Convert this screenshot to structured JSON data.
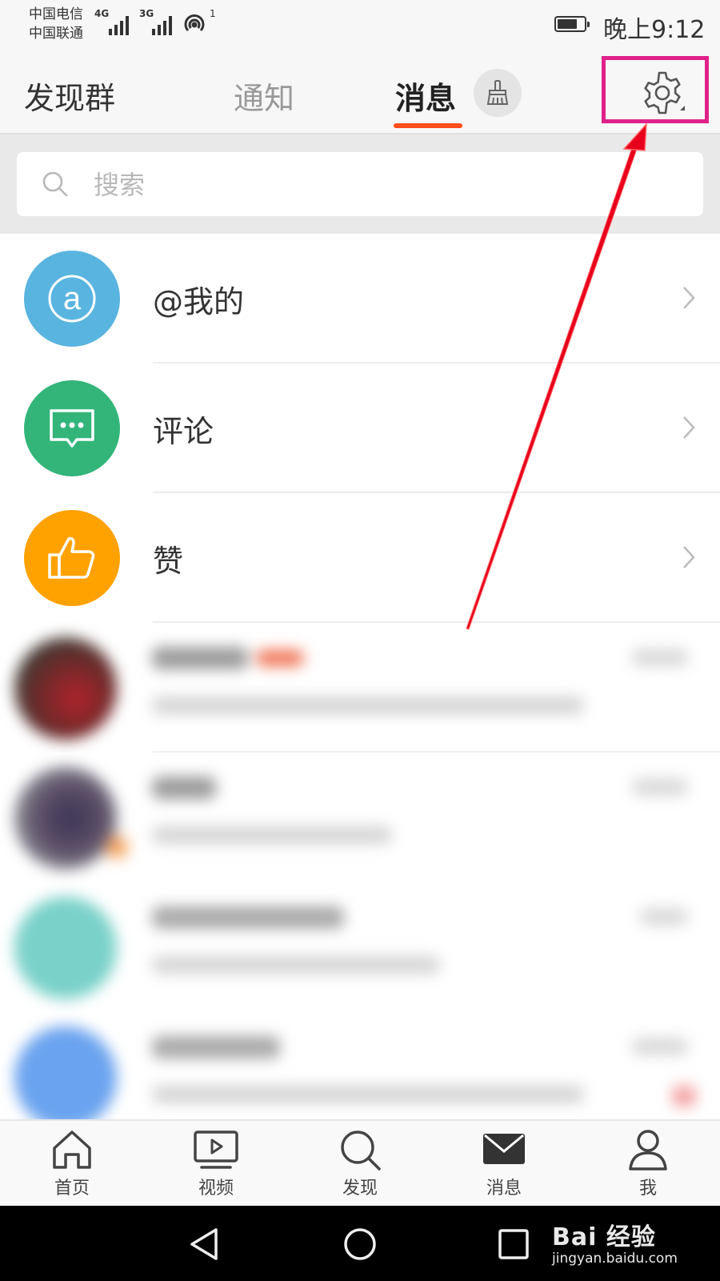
{
  "status_bar": {
    "carrier_1": "中国电信",
    "carrier_2": "中国联通",
    "network_1": "4G",
    "network_2": "3G",
    "wifi_badge": "1",
    "time": "晚上9:12",
    "battery_level": 0.75
  },
  "top_tabs": {
    "groups": "发现群",
    "notifications": "通知",
    "messages": "消息",
    "active_tab": "消息"
  },
  "search": {
    "placeholder": "搜索"
  },
  "notification_rows": [
    {
      "label": "@我的",
      "icon": "at-icon",
      "color": "#5ab4e0"
    },
    {
      "label": "评论",
      "icon": "comment-icon",
      "color": "#33b57a"
    },
    {
      "label": "赞",
      "icon": "thumbs-up-icon",
      "color": "#ffa200"
    }
  ],
  "bottom_nav": {
    "home": "首页",
    "video": "视频",
    "discover": "发现",
    "messages": "消息",
    "me": "我",
    "active": "消息"
  },
  "watermark": {
    "brand": "Bai  经验",
    "url": "jingyan.baidu.com"
  },
  "colors": {
    "accent": "#ff4d1a",
    "highlight": "#e0218a",
    "arrow": "#e8001c"
  }
}
